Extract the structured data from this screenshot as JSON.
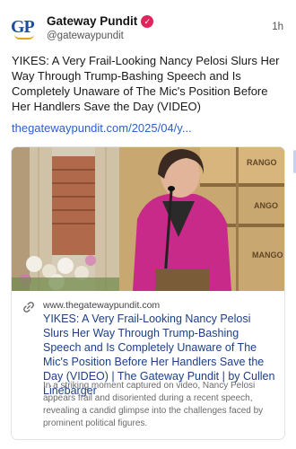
{
  "author": {
    "name": "Gateway Pundit",
    "handle": "@gatewaypundit",
    "logo_text": "GP",
    "verified_icon": "verified-badge-icon",
    "time": "1h"
  },
  "post": {
    "text": "YIKES: A Very Frail-Looking Nancy Pelosi Slurs Her Way Through Trump-Bashing Speech and Is Completely Unaware of The Mic's Position Before Her Handlers Save the Day (VIDEO)",
    "link": "thegatewaypundit.com/2025/04/y..."
  },
  "card": {
    "domain": "www.thegatewaypundit.com",
    "title": "YIKES: A Very Frail-Looking Nancy Pelosi Slurs Her Way Through Trump-Bashing Speech and Is Completely Unaware of The Mic's Position Before Her Handlers Save the Day (VIDEO) | The Gateway Pundit | by Cullen Linebarger",
    "description": "In a striking moment captured on video, Nancy Pelosi appears frail and disoriented during a recent speech, revealing a candid glimpse into the challenges faced by prominent political figures.",
    "image_crate_texts": [
      "RANGO",
      "ANGO",
      "MANGO"
    ]
  },
  "colors": {
    "link": "#2c62c9",
    "card_title": "#1e3f84",
    "badge": "#e0245e",
    "logo_blue": "#1e4f9c",
    "logo_orange": "#e5a31c"
  }
}
